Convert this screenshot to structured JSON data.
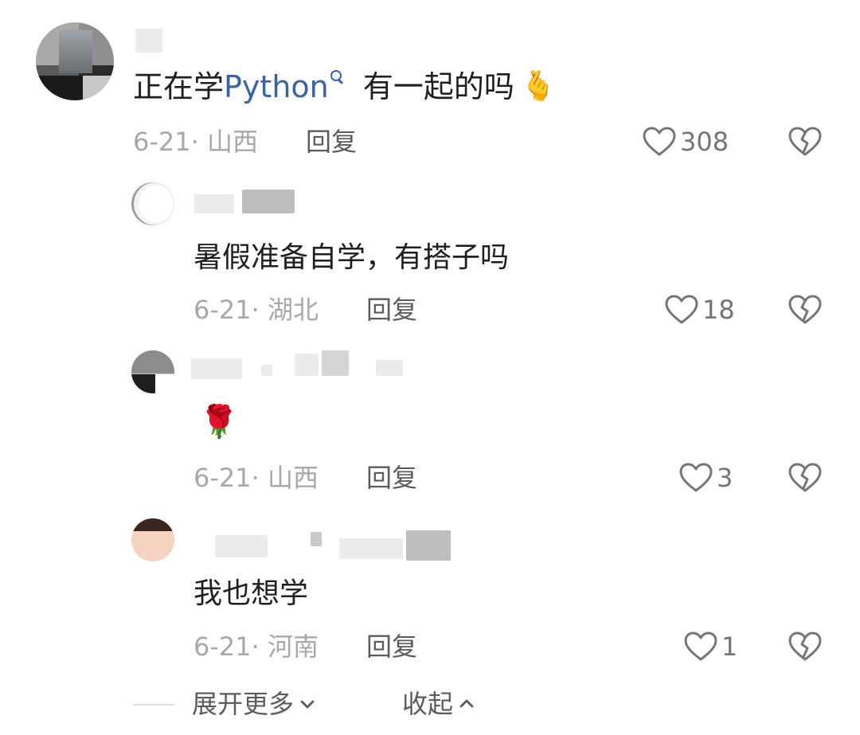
{
  "comments": [
    {
      "text_prefix": "正在学",
      "link": "Python",
      "text_suffix": "有一起的吗",
      "emoji": "🫰",
      "date_location": "6-21· 山西",
      "reply_label": "回复",
      "like_count": "308"
    },
    {
      "text": "暑假准备自学，有搭子吗",
      "date_location": "6-21· 湖北",
      "reply_label": "回复",
      "like_count": "18"
    },
    {
      "emoji": "🌹",
      "date_location": "6-21· 山西",
      "reply_label": "回复",
      "like_count": "3"
    },
    {
      "text": "我也想学",
      "date_location": "6-21· 河南",
      "reply_label": "回复",
      "like_count": "1"
    }
  ],
  "footer": {
    "expand_label": "展开更多",
    "collapse_label": "收起"
  },
  "icons": {
    "like": "heart-outline-icon",
    "dislike": "broken-heart-icon",
    "search": "search-icon",
    "expand": "chevron-down-icon",
    "collapse": "chevron-up-icon"
  },
  "colors": {
    "link": "#3a62a8",
    "meta": "#a8a8a8",
    "icon": "#757575"
  }
}
